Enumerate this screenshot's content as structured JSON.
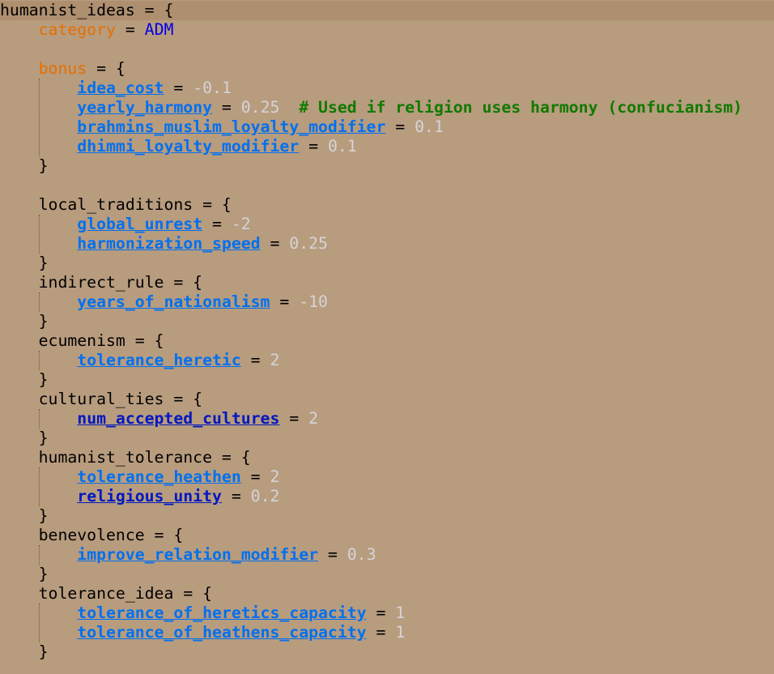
{
  "editor": {
    "background": "#B89C7E",
    "current_line_background": "#AE8F6F",
    "colors": {
      "plain": "#000000",
      "keyword": "#E56F00",
      "modifier": "#0070F0",
      "modifier_alt": "#0018C0",
      "number": "#D4D4D8",
      "constant": "#0000E8",
      "comment": "#107A00"
    },
    "lines": [
      {
        "tokens": [
          {
            "t": "plain",
            "v": "humanist_ideas = {"
          }
        ]
      },
      {
        "tokens": [
          {
            "t": "plain",
            "v": "    "
          },
          {
            "t": "key",
            "v": "category"
          },
          {
            "t": "plain",
            "v": " = "
          },
          {
            "t": "const",
            "v": "ADM"
          }
        ]
      },
      {
        "tokens": []
      },
      {
        "tokens": [
          {
            "t": "plain",
            "v": "    "
          },
          {
            "t": "key",
            "v": "bonus"
          },
          {
            "t": "plain",
            "v": " = {"
          }
        ]
      },
      {
        "tokens": [
          {
            "t": "plain",
            "v": "        "
          },
          {
            "t": "mod",
            "v": "idea_cost"
          },
          {
            "t": "plain",
            "v": " = "
          },
          {
            "t": "num",
            "v": "-0.1"
          }
        ]
      },
      {
        "tokens": [
          {
            "t": "plain",
            "v": "        "
          },
          {
            "t": "mod",
            "v": "yearly_harmony"
          },
          {
            "t": "plain",
            "v": " = "
          },
          {
            "t": "num",
            "v": "0.25"
          },
          {
            "t": "plain",
            "v": "  "
          },
          {
            "t": "cmt",
            "v": "# Used if religion uses harmony (confucianism)"
          }
        ]
      },
      {
        "tokens": [
          {
            "t": "plain",
            "v": "        "
          },
          {
            "t": "mod",
            "v": "brahmins_muslim_loyalty_modifier"
          },
          {
            "t": "plain",
            "v": " = "
          },
          {
            "t": "num",
            "v": "0.1"
          }
        ]
      },
      {
        "tokens": [
          {
            "t": "plain",
            "v": "        "
          },
          {
            "t": "mod",
            "v": "dhimmi_loyalty_modifier"
          },
          {
            "t": "plain",
            "v": " = "
          },
          {
            "t": "num",
            "v": "0.1"
          }
        ]
      },
      {
        "tokens": [
          {
            "t": "plain",
            "v": "    }"
          }
        ]
      },
      {
        "tokens": []
      },
      {
        "tokens": [
          {
            "t": "plain",
            "v": "    local_traditions = {"
          }
        ]
      },
      {
        "tokens": [
          {
            "t": "plain",
            "v": "        "
          },
          {
            "t": "mod",
            "v": "global_unrest"
          },
          {
            "t": "plain",
            "v": " = "
          },
          {
            "t": "num",
            "v": "-2"
          }
        ]
      },
      {
        "tokens": [
          {
            "t": "plain",
            "v": "        "
          },
          {
            "t": "mod",
            "v": "harmonization_speed"
          },
          {
            "t": "plain",
            "v": " = "
          },
          {
            "t": "num",
            "v": "0.25"
          }
        ]
      },
      {
        "tokens": [
          {
            "t": "plain",
            "v": "    }"
          }
        ]
      },
      {
        "tokens": [
          {
            "t": "plain",
            "v": "    indirect_rule = {"
          }
        ]
      },
      {
        "tokens": [
          {
            "t": "plain",
            "v": "        "
          },
          {
            "t": "mod",
            "v": "years_of_nationalism"
          },
          {
            "t": "plain",
            "v": " = "
          },
          {
            "t": "num",
            "v": "-10"
          }
        ]
      },
      {
        "tokens": [
          {
            "t": "plain",
            "v": "    }"
          }
        ]
      },
      {
        "tokens": [
          {
            "t": "plain",
            "v": "    ecumenism = {"
          }
        ]
      },
      {
        "tokens": [
          {
            "t": "plain",
            "v": "        "
          },
          {
            "t": "mod",
            "v": "tolerance_heretic"
          },
          {
            "t": "plain",
            "v": " = "
          },
          {
            "t": "num",
            "v": "2"
          }
        ]
      },
      {
        "tokens": [
          {
            "t": "plain",
            "v": "    }"
          }
        ]
      },
      {
        "tokens": [
          {
            "t": "plain",
            "v": "    cultural_ties = {"
          }
        ]
      },
      {
        "tokens": [
          {
            "t": "plain",
            "v": "        "
          },
          {
            "t": "mod2",
            "v": "num_accepted_cultures"
          },
          {
            "t": "plain",
            "v": " = "
          },
          {
            "t": "num",
            "v": "2"
          }
        ]
      },
      {
        "tokens": [
          {
            "t": "plain",
            "v": "    }"
          }
        ]
      },
      {
        "tokens": [
          {
            "t": "plain",
            "v": "    humanist_tolerance = {"
          }
        ]
      },
      {
        "tokens": [
          {
            "t": "plain",
            "v": "        "
          },
          {
            "t": "mod",
            "v": "tolerance_heathen"
          },
          {
            "t": "plain",
            "v": " = "
          },
          {
            "t": "num",
            "v": "2"
          }
        ]
      },
      {
        "tokens": [
          {
            "t": "plain",
            "v": "        "
          },
          {
            "t": "mod2",
            "v": "religious_unity"
          },
          {
            "t": "plain",
            "v": " = "
          },
          {
            "t": "num",
            "v": "0.2"
          }
        ]
      },
      {
        "tokens": [
          {
            "t": "plain",
            "v": "    }"
          }
        ]
      },
      {
        "tokens": [
          {
            "t": "plain",
            "v": "    benevolence = {"
          }
        ]
      },
      {
        "tokens": [
          {
            "t": "plain",
            "v": "        "
          },
          {
            "t": "mod",
            "v": "improve_relation_modifier"
          },
          {
            "t": "plain",
            "v": " = "
          },
          {
            "t": "num",
            "v": "0.3"
          }
        ]
      },
      {
        "tokens": [
          {
            "t": "plain",
            "v": "    }"
          }
        ]
      },
      {
        "tokens": [
          {
            "t": "plain",
            "v": "    tolerance_idea = {"
          }
        ]
      },
      {
        "tokens": [
          {
            "t": "plain",
            "v": "        "
          },
          {
            "t": "mod",
            "v": "tolerance_of_heretics_capacity"
          },
          {
            "t": "plain",
            "v": " = "
          },
          {
            "t": "num",
            "v": "1"
          }
        ]
      },
      {
        "tokens": [
          {
            "t": "plain",
            "v": "        "
          },
          {
            "t": "mod",
            "v": "tolerance_of_heathens_capacity"
          },
          {
            "t": "plain",
            "v": " = "
          },
          {
            "t": "num",
            "v": "1"
          }
        ]
      },
      {
        "tokens": [
          {
            "t": "plain",
            "v": "    }"
          }
        ]
      }
    ]
  }
}
